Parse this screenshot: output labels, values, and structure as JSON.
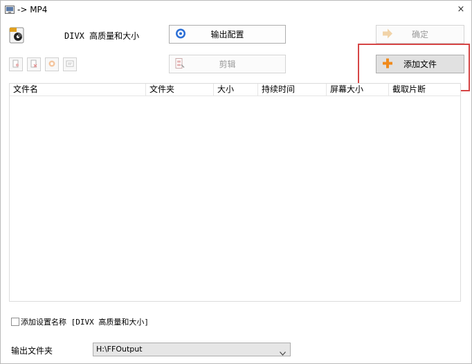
{
  "window": {
    "title": "-> MP4",
    "close_glyph": "×"
  },
  "profile": {
    "name": "DIVX 高质量和大小"
  },
  "buttons": {
    "output_config": "输出配置",
    "edit": "剪辑",
    "confirm": "确定",
    "add_file": "添加文件"
  },
  "colors": {
    "highlight": "#d64545",
    "add_plus": "#f08a1c"
  },
  "file_list": {
    "columns": [
      "文件名",
      "文件夹",
      "大小",
      "持续时间",
      "屏幕大小",
      "截取片断"
    ],
    "rows": []
  },
  "options": {
    "add_setting_name_checked": false,
    "add_setting_name_label": "添加设置名称 [DIVX 高质量和大小]"
  },
  "output": {
    "folder_label": "输出文件夹",
    "folder_value": "H:\\FFOutput"
  }
}
